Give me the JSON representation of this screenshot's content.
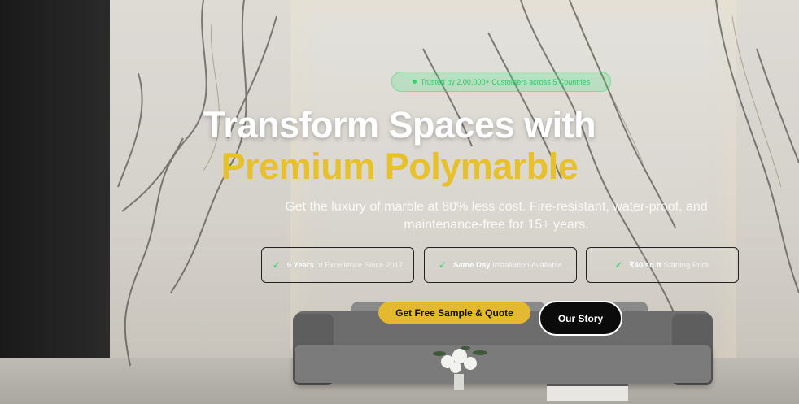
{
  "hero": {
    "badge_text": "Trusted by 2,00,000+ Customers across 5 Countries",
    "title_line1": "Transform Spaces with",
    "title_line2": "Premium Polymarble",
    "subtitle": "Get the luxury of marble at 80% less cost. Fire-resistant, water-proof, and maintenance-free for 15+ years.",
    "features": [
      {
        "strong": "9 Years",
        "rest": " of Excellence Since 2017",
        "icon": "check-icon"
      },
      {
        "strong": "Same Day",
        "rest": " Installation Available",
        "icon": "check-icon"
      },
      {
        "strong": "₹40/sq.ft",
        "rest": " Starting Price",
        "icon": "check-icon"
      }
    ],
    "primary_button": "Get Free Sample & Quote",
    "secondary_button": "Our Story"
  },
  "colors": {
    "accent_gold": "#e3b930",
    "title_gold": "#e6c12a",
    "badge_green": "#39d26a",
    "dark": "#0b0b0b"
  }
}
